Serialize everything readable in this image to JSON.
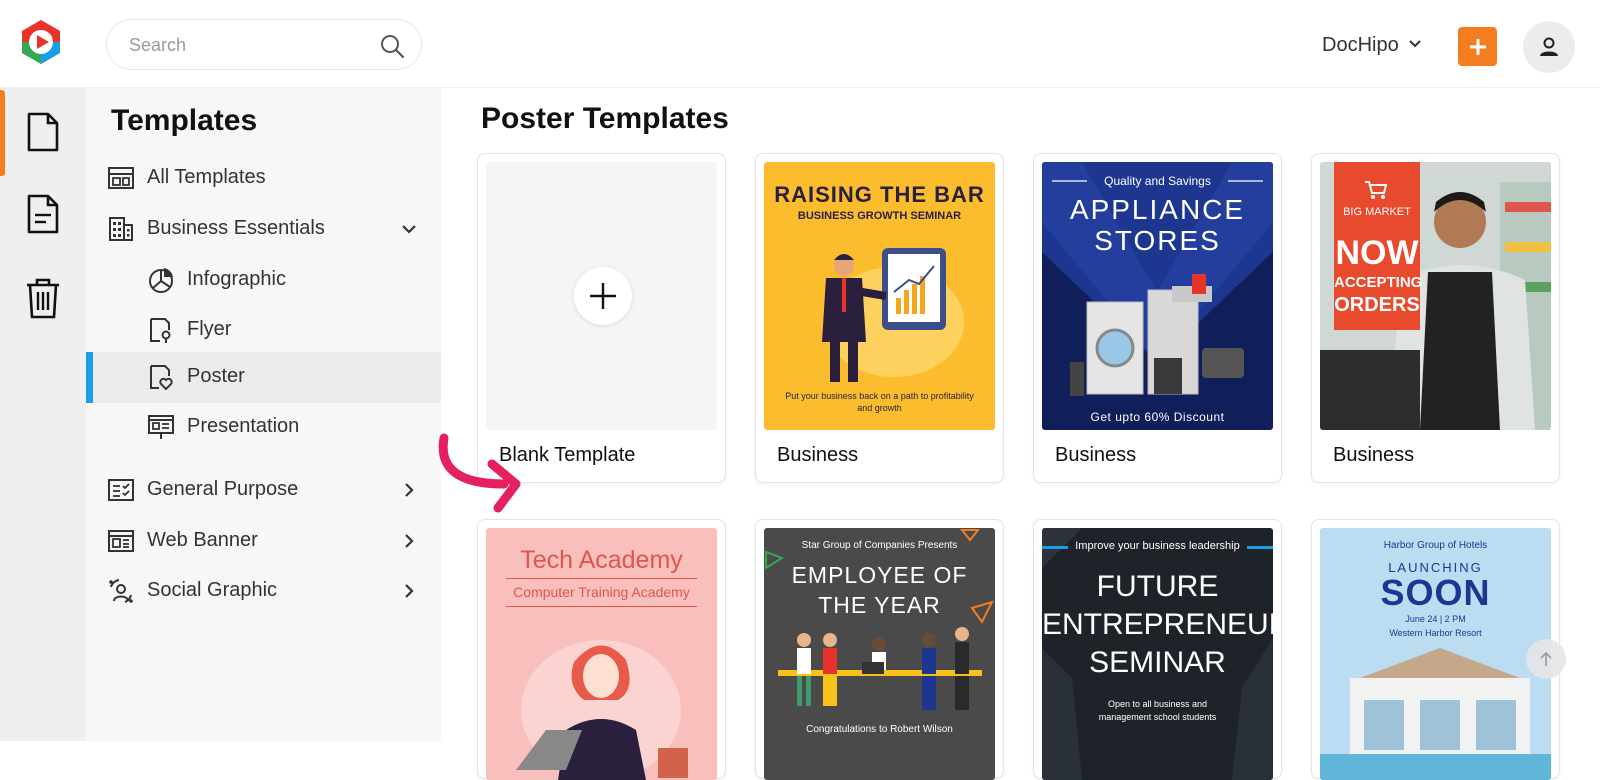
{
  "header": {
    "search_placeholder": "Search",
    "workspace_label": "DocHipo",
    "accent_color": "#f47d20"
  },
  "sidebar": {
    "title": "Templates",
    "items": [
      {
        "label": "All Templates",
        "icon": "layout-grid-icon"
      },
      {
        "label": "Business Essentials",
        "icon": "building-icon",
        "expanded": true
      },
      {
        "label": "Infographic",
        "icon": "pie-chart-icon"
      },
      {
        "label": "Flyer",
        "icon": "flyer-icon"
      },
      {
        "label": "Poster",
        "icon": "poster-icon",
        "active": true
      },
      {
        "label": "Presentation",
        "icon": "presentation-icon"
      },
      {
        "label": "General Purpose",
        "icon": "checklist-icon"
      },
      {
        "label": "Web Banner",
        "icon": "web-banner-icon"
      },
      {
        "label": "Social Graphic",
        "icon": "social-graphic-icon"
      }
    ]
  },
  "main": {
    "title": "Poster Templates",
    "cards": [
      {
        "label": "Blank Template"
      },
      {
        "label": "Business"
      },
      {
        "label": "Business"
      },
      {
        "label": "Business"
      }
    ],
    "posters": {
      "raising": {
        "title": "RAISING THE BAR",
        "subtitle": "BUSINESS GROWTH SEMINAR",
        "footer": "Put your business back on a path to profitability and growth"
      },
      "appliance": {
        "top": "Quality and Savings",
        "title1": "APPLIANCE",
        "title2": "STORES",
        "footer": "Get upto 60% Discount"
      },
      "bigmarket": {
        "top": "BIG MARKET",
        "l1": "NOW",
        "l2": "ACCEPTING",
        "l3": "ORDERS"
      },
      "tech": {
        "title": "Tech Academy",
        "subtitle": "Computer Training Academy"
      },
      "employee": {
        "top": "Star Group of Companies Presents",
        "l1": "EMPLOYEE OF",
        "l2": "THE YEAR",
        "footer": "Congratulations to Robert Wilson"
      },
      "future": {
        "top": "Improve your business leadership",
        "l1": "FUTURE",
        "l2": "ENTREPRENEUR",
        "l3": "SEMINAR",
        "footer": "Open to all business and management school students"
      },
      "launch": {
        "top": "Harbor Group of Hotels",
        "l1": "LAUNCHING",
        "l2": "SOON",
        "date": "June 24 | 2 PM",
        "place": "Western Harbor Resort"
      }
    }
  }
}
